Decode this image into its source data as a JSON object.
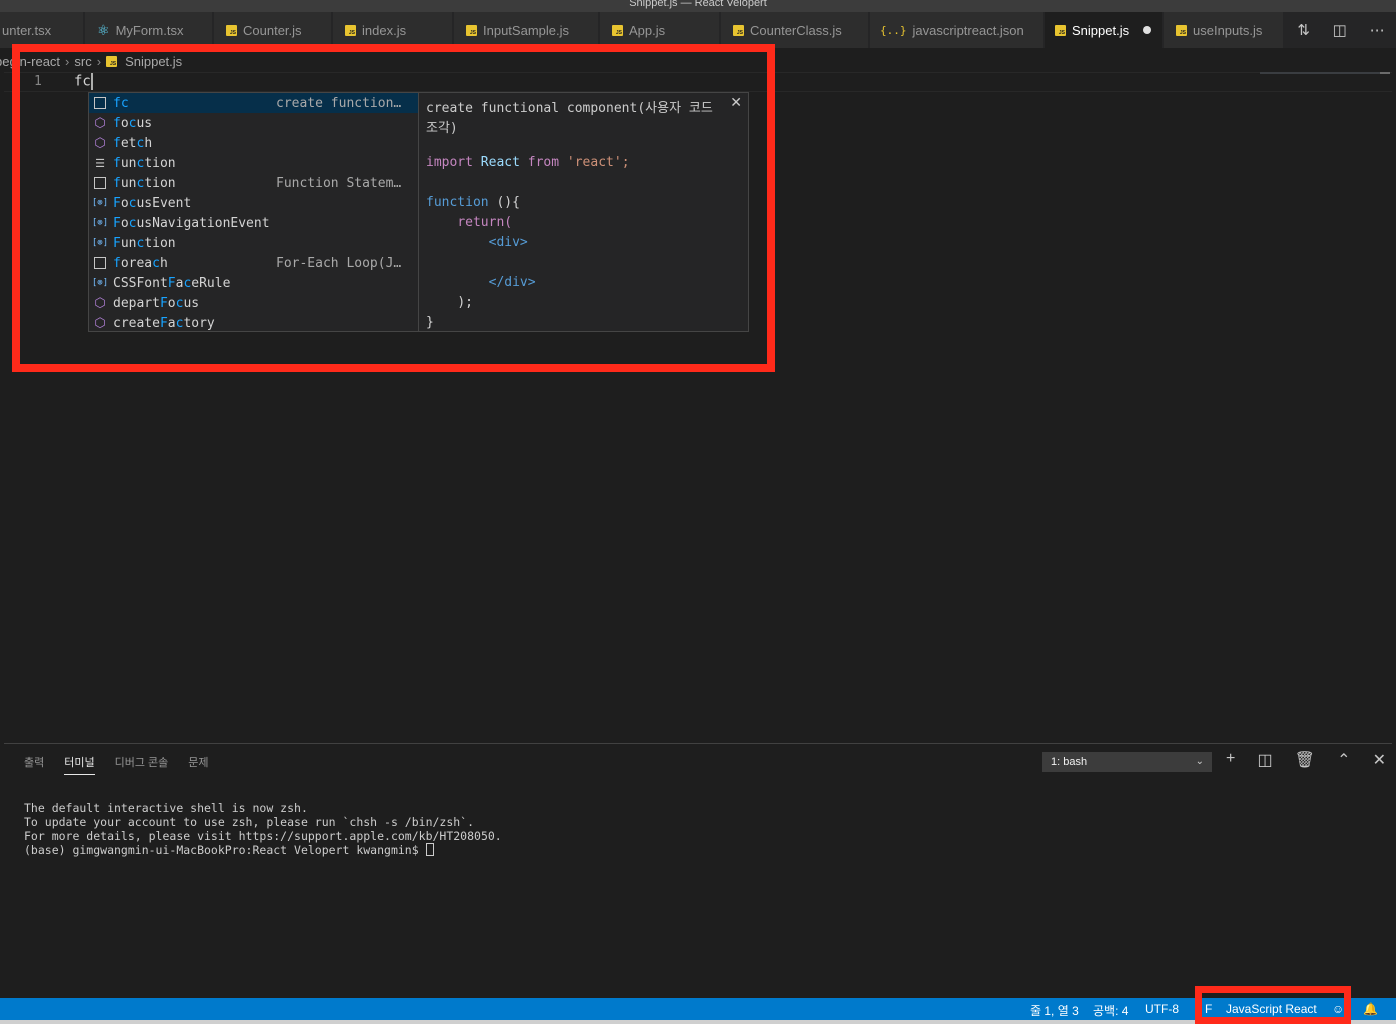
{
  "window": {
    "title": "Snippet.js — React Velopert"
  },
  "tabs": [
    {
      "label": "unter.tsx",
      "icon": "typescript-react-icon"
    },
    {
      "label": "MyForm.tsx",
      "icon": "react-icon"
    },
    {
      "label": "Counter.js",
      "icon": "javascript-icon"
    },
    {
      "label": "index.js",
      "icon": "javascript-icon"
    },
    {
      "label": "InputSample.js",
      "icon": "javascript-icon"
    },
    {
      "label": "App.js",
      "icon": "javascript-icon"
    },
    {
      "label": "CounterClass.js",
      "icon": "javascript-icon"
    },
    {
      "label": "javascriptreact.json",
      "icon": "json-icon"
    },
    {
      "label": "Snippet.js",
      "icon": "javascript-icon",
      "active": true,
      "modified": true
    },
    {
      "label": "useInputs.js",
      "icon": "javascript-icon"
    }
  ],
  "breadcrumb": {
    "folder": "begin-react",
    "subfolder": "src",
    "file": "Snippet.js"
  },
  "editor": {
    "line_number": "1",
    "typed_text": "fc"
  },
  "suggestions": [
    {
      "pre": "",
      "hl": "fc",
      "post": "",
      "detail": "create function…",
      "icon": "snippet-icon",
      "selected": true
    },
    {
      "pre": "",
      "hl": "f",
      "hl2": "",
      "post": "o",
      "hl3": "c",
      "post2": "us",
      "detail": "",
      "icon": "method-icon"
    },
    {
      "pre": "",
      "hl": "f",
      "post": "et",
      "hl3": "c",
      "post2": "h",
      "detail": "",
      "icon": "method-icon"
    },
    {
      "pre": "",
      "hl": "f",
      "post": "un",
      "hl3": "c",
      "post2": "tion",
      "detail": "",
      "icon": "keyword-icon"
    },
    {
      "pre": "",
      "hl": "f",
      "post": "un",
      "hl3": "c",
      "post2": "tion",
      "detail": "Function Statem…",
      "icon": "snippet-icon"
    },
    {
      "pre": "",
      "hl": "F",
      "post": "o",
      "hl3": "c",
      "post2": "usEvent",
      "detail": "",
      "icon": "variable-icon"
    },
    {
      "pre": "",
      "hl": "F",
      "post": "o",
      "hl3": "c",
      "post2": "usNavigationEvent",
      "detail": "",
      "icon": "variable-icon"
    },
    {
      "pre": "",
      "hl": "F",
      "post": "un",
      "hl3": "c",
      "post2": "tion",
      "detail": "",
      "icon": "variable-icon"
    },
    {
      "pre": "",
      "hl": "f",
      "post": "orea",
      "hl3": "c",
      "post2": "h",
      "detail": "For-Each Loop(J…",
      "icon": "snippet-icon"
    },
    {
      "pre": "CSSFont",
      "hl": "F",
      "post": "a",
      "hl3": "c",
      "post2": "eRule",
      "detail": "",
      "icon": "variable-icon"
    },
    {
      "pre": "depart",
      "hl": "F",
      "post": "o",
      "hl3": "c",
      "post2": "us",
      "detail": "",
      "icon": "method-icon"
    },
    {
      "pre": "create",
      "hl": "F",
      "post": "a",
      "hl3": "c",
      "post2": "tory",
      "detail": "",
      "icon": "method-icon"
    }
  ],
  "details": {
    "description": "create functional component(사용자 코드 조각)",
    "code": {
      "import_kw": "import",
      "react_ident": "React",
      "from_kw": "from",
      "react_str": "'react';",
      "function_kw": "function",
      "paren_brace": " (){",
      "return_kw": "return(",
      "open_div": "<div>",
      "close_div": "</div>",
      "close_paren": ");",
      "close_brace": "}"
    }
  },
  "panel": {
    "tabs": [
      "출력",
      "터미널",
      "디버그 콘솔",
      "문제"
    ],
    "active_tab": "터미널",
    "terminal_select": "1: bash",
    "terminal_lines": [
      "The default interactive shell is now zsh.",
      "To update your account to use zsh, please run `chsh -s /bin/zsh`.",
      "For more details, please visit https://support.apple.com/kb/HT208050.",
      "(base) gimgwangmin-ui-MacBookPro:React Velopert kwangmin$ "
    ]
  },
  "statusbar": {
    "position": "줄 1, 열 3",
    "indent": "공백: 4",
    "encoding": "UTF-8",
    "eol": "F",
    "language": "JavaScript React"
  },
  "colors": {
    "accent": "#007acc",
    "highlight_box": "#ff2a1a",
    "match": "#18a3ff"
  }
}
